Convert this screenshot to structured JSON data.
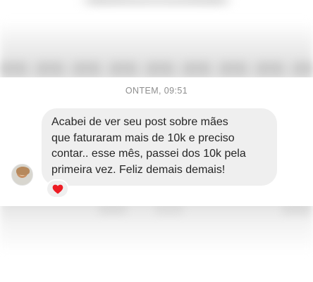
{
  "conversation": {
    "timestamp": "ONTEM, 09:51",
    "message": {
      "lines": [
        "Acabei de ver seu post sobre mães",
        "que faturaram mais de 10k e preciso",
        "contar.. esse mês, passei dos 10k pela",
        "primeira vez. Feliz demais demais!"
      ],
      "reaction": {
        "icon": "heart-icon",
        "color": "#ed1c24"
      }
    },
    "bubble_color": "#efefef",
    "text_color": "#262626",
    "timestamp_color": "#8e8e8e"
  }
}
